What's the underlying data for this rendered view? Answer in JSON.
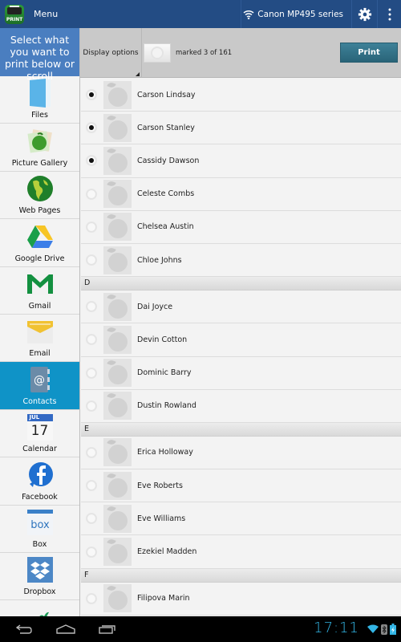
{
  "app": {
    "icon_label": "PRINT",
    "menu_label": "Menu",
    "printer_name": "Canon MP495 series"
  },
  "colors": {
    "action_bar": "#234c84",
    "sidebar_header": "#4a7ec0",
    "selected_item": "#0f93c7",
    "print_button": "#336f85",
    "clock": "#33b5e5"
  },
  "sidebar": {
    "header": "Select what you want to print below or scroll",
    "items": [
      {
        "label": "Files",
        "icon": "folder-icon"
      },
      {
        "label": "Picture Gallery",
        "icon": "picture-gallery-icon"
      },
      {
        "label": "Web Pages",
        "icon": "globe-icon"
      },
      {
        "label": "Google Drive",
        "icon": "google-drive-icon"
      },
      {
        "label": "Gmail",
        "icon": "gmail-icon"
      },
      {
        "label": "Email",
        "icon": "email-icon"
      },
      {
        "label": "Contacts",
        "icon": "contacts-icon",
        "selected": true
      },
      {
        "label": "Calendar",
        "icon": "calendar-icon",
        "month": "JUL",
        "day": "17"
      },
      {
        "label": "Facebook",
        "icon": "facebook-icon"
      },
      {
        "label": "Box",
        "icon": "box-icon"
      },
      {
        "label": "Dropbox",
        "icon": "dropbox-icon"
      },
      {
        "label": "",
        "icon": "hummingbird-icon"
      }
    ]
  },
  "toolbar": {
    "display_options": "Display options",
    "marked_text": "marked 3 of 161",
    "print_label": "Print"
  },
  "contacts": {
    "groups": [
      {
        "letter": "",
        "items": [
          {
            "name": "Carson Lindsay",
            "checked": true
          },
          {
            "name": "Carson Stanley",
            "checked": true
          },
          {
            "name": "Cassidy Dawson",
            "checked": true
          },
          {
            "name": "Celeste Combs",
            "checked": false
          },
          {
            "name": "Chelsea Austin",
            "checked": false
          },
          {
            "name": "Chloe Johns",
            "checked": false
          }
        ]
      },
      {
        "letter": "D",
        "items": [
          {
            "name": "Dai Joyce",
            "checked": false
          },
          {
            "name": "Devin Cotton",
            "checked": false
          },
          {
            "name": "Dominic Barry",
            "checked": false
          },
          {
            "name": "Dustin Rowland",
            "checked": false
          }
        ]
      },
      {
        "letter": "E",
        "items": [
          {
            "name": "Erica Holloway",
            "checked": false
          },
          {
            "name": "Eve Roberts",
            "checked": false
          },
          {
            "name": "Eve Williams",
            "checked": false
          },
          {
            "name": "Ezekiel Madden",
            "checked": false
          }
        ]
      },
      {
        "letter": "F",
        "items": [
          {
            "name": "Filipova Marin",
            "checked": false
          },
          {
            "name": "",
            "checked": false
          }
        ]
      }
    ]
  },
  "system": {
    "clock": "17:11"
  }
}
